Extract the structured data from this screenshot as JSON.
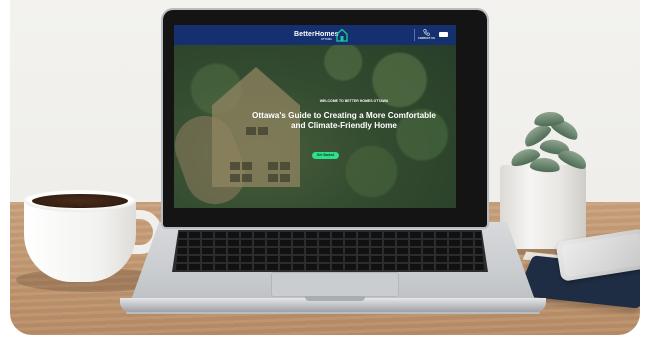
{
  "site": {
    "brand": "BetterHomes",
    "brand_sub": "OTTAWA",
    "contact_label": "CONTACT US"
  },
  "hero": {
    "eyebrow": "WELCOME TO BETTER HOMES OTTAWA",
    "title": "Ottawa's Guide to Creating a More Comfortable and Climate-Friendly Home",
    "cta_label": "Get Started"
  },
  "colors": {
    "navbar": "#14306f",
    "cta": "#2ee08a"
  },
  "icons": [
    "house-logo-icon",
    "phone-icon",
    "language-toggle-icon"
  ]
}
